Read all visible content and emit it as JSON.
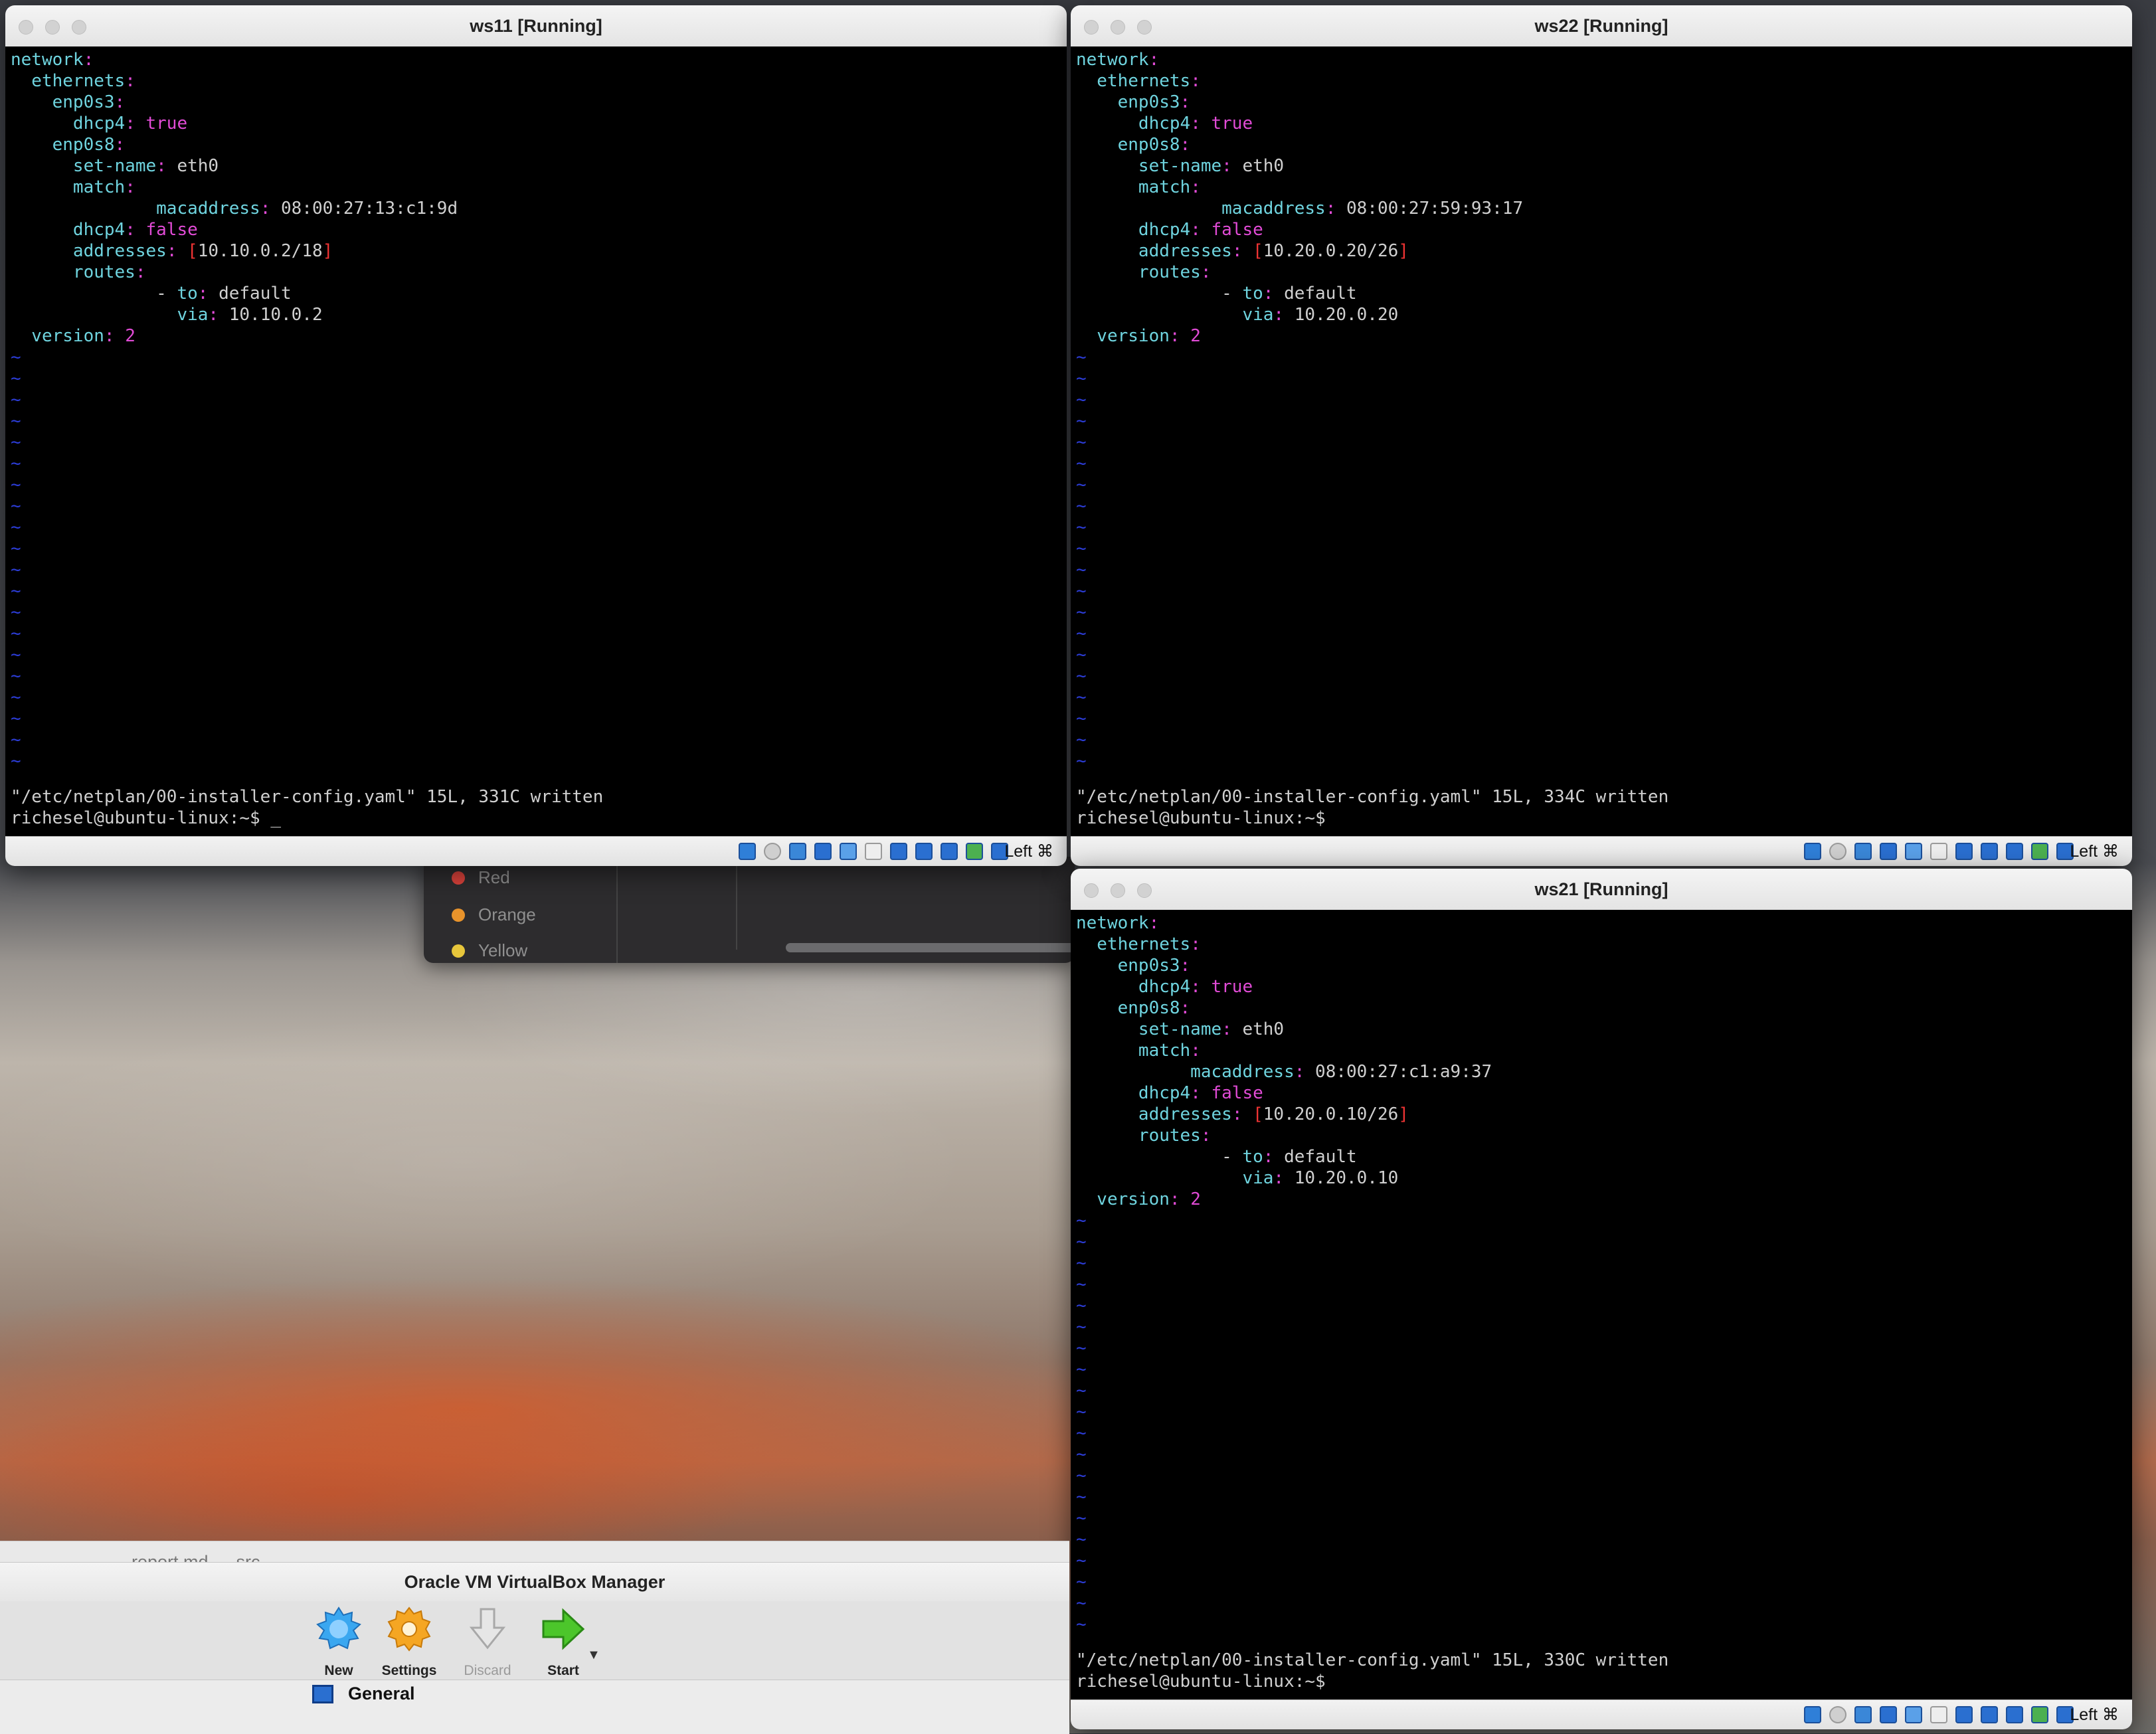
{
  "windows": {
    "ws11": {
      "title": "ws11 [Running]",
      "lines": [
        [
          {
            "t": "network",
            "c": "k"
          },
          {
            "t": ":",
            "c": "p"
          }
        ],
        [
          {
            "t": "  ethernets",
            "c": "k"
          },
          {
            "t": ":",
            "c": "p"
          }
        ],
        [
          {
            "t": "    enp0s3",
            "c": "k"
          },
          {
            "t": ":",
            "c": "p"
          }
        ],
        [
          {
            "t": "      dhcp4",
            "c": "k"
          },
          {
            "t": ": ",
            "c": "p"
          },
          {
            "t": "true",
            "c": "p"
          }
        ],
        [
          {
            "t": "    enp0s8",
            "c": "k"
          },
          {
            "t": ":",
            "c": "p"
          }
        ],
        [
          {
            "t": "      set-name",
            "c": "k"
          },
          {
            "t": ": ",
            "c": "p"
          },
          {
            "t": "eth0",
            "c": "v"
          }
        ],
        [
          {
            "t": "      match",
            "c": "k"
          },
          {
            "t": ":",
            "c": "p"
          }
        ],
        [
          {
            "t": "              macaddress",
            "c": "k"
          },
          {
            "t": ": ",
            "c": "p"
          },
          {
            "t": "08:00:27:13:c1:9d",
            "c": "v"
          }
        ],
        [
          {
            "t": "      dhcp4",
            "c": "k"
          },
          {
            "t": ": ",
            "c": "p"
          },
          {
            "t": "false",
            "c": "p"
          }
        ],
        [
          {
            "t": "      addresses",
            "c": "k"
          },
          {
            "t": ": ",
            "c": "p"
          },
          {
            "t": "[",
            "c": "br"
          },
          {
            "t": "10.10.0.2/18",
            "c": "v"
          },
          {
            "t": "]",
            "c": "br"
          }
        ],
        [
          {
            "t": "      routes",
            "c": "k"
          },
          {
            "t": ":",
            "c": "p"
          }
        ],
        [
          {
            "t": "              - ",
            "c": "v"
          },
          {
            "t": "to",
            "c": "k"
          },
          {
            "t": ": ",
            "c": "p"
          },
          {
            "t": "default",
            "c": "v"
          }
        ],
        [
          {
            "t": "                via",
            "c": "k"
          },
          {
            "t": ": ",
            "c": "p"
          },
          {
            "t": "10.10.0.2",
            "c": "v"
          }
        ],
        [
          {
            "t": "  version",
            "c": "k"
          },
          {
            "t": ": ",
            "c": "p"
          },
          {
            "t": "2",
            "c": "p"
          }
        ]
      ],
      "status_line": "\"/etc/netplan/00-installer-config.yaml\" 15L, 331C written",
      "prompt": "richesel@ubuntu-linux:~$ ",
      "cursor": "_",
      "host_key": "Left ⌘"
    },
    "ws22": {
      "title": "ws22 [Running]",
      "lines": [
        [
          {
            "t": "network",
            "c": "k"
          },
          {
            "t": ":",
            "c": "p"
          }
        ],
        [
          {
            "t": "  ethernets",
            "c": "k"
          },
          {
            "t": ":",
            "c": "p"
          }
        ],
        [
          {
            "t": "    enp0s3",
            "c": "k"
          },
          {
            "t": ":",
            "c": "p"
          }
        ],
        [
          {
            "t": "      dhcp4",
            "c": "k"
          },
          {
            "t": ": ",
            "c": "p"
          },
          {
            "t": "true",
            "c": "p"
          }
        ],
        [
          {
            "t": "    enp0s8",
            "c": "k"
          },
          {
            "t": ":",
            "c": "p"
          }
        ],
        [
          {
            "t": "      set-name",
            "c": "k"
          },
          {
            "t": ": ",
            "c": "p"
          },
          {
            "t": "eth0",
            "c": "v"
          }
        ],
        [
          {
            "t": "      match",
            "c": "k"
          },
          {
            "t": ":",
            "c": "p"
          }
        ],
        [
          {
            "t": "              macaddress",
            "c": "k"
          },
          {
            "t": ": ",
            "c": "p"
          },
          {
            "t": "08:00:27:59:93:17",
            "c": "v"
          }
        ],
        [
          {
            "t": "      dhcp4",
            "c": "k"
          },
          {
            "t": ": ",
            "c": "p"
          },
          {
            "t": "false",
            "c": "p"
          }
        ],
        [
          {
            "t": "      addresses",
            "c": "k"
          },
          {
            "t": ": ",
            "c": "p"
          },
          {
            "t": "[",
            "c": "br"
          },
          {
            "t": "10.20.0.20/26",
            "c": "v"
          },
          {
            "t": "]",
            "c": "br"
          }
        ],
        [
          {
            "t": "      routes",
            "c": "k"
          },
          {
            "t": ":",
            "c": "p"
          }
        ],
        [
          {
            "t": "              - ",
            "c": "v"
          },
          {
            "t": "to",
            "c": "k"
          },
          {
            "t": ": ",
            "c": "p"
          },
          {
            "t": "default",
            "c": "v"
          }
        ],
        [
          {
            "t": "                via",
            "c": "k"
          },
          {
            "t": ": ",
            "c": "p"
          },
          {
            "t": "10.20.0.20",
            "c": "v"
          }
        ],
        [
          {
            "t": "  version",
            "c": "k"
          },
          {
            "t": ": ",
            "c": "p"
          },
          {
            "t": "2",
            "c": "p"
          }
        ]
      ],
      "status_line": "\"/etc/netplan/00-installer-config.yaml\" 15L, 334C written",
      "prompt": "richesel@ubuntu-linux:~$",
      "cursor": "",
      "host_key": "Left ⌘"
    },
    "ws21": {
      "title": "ws21 [Running]",
      "lines": [
        [
          {
            "t": "network",
            "c": "k"
          },
          {
            "t": ":",
            "c": "p"
          }
        ],
        [
          {
            "t": "  ethernets",
            "c": "k"
          },
          {
            "t": ":",
            "c": "p"
          }
        ],
        [
          {
            "t": "    enp0s3",
            "c": "k"
          },
          {
            "t": ":",
            "c": "p"
          }
        ],
        [
          {
            "t": "      dhcp4",
            "c": "k"
          },
          {
            "t": ": ",
            "c": "p"
          },
          {
            "t": "true",
            "c": "p"
          }
        ],
        [
          {
            "t": "    enp0s8",
            "c": "k"
          },
          {
            "t": ":",
            "c": "p"
          }
        ],
        [
          {
            "t": "      set-name",
            "c": "k"
          },
          {
            "t": ": ",
            "c": "p"
          },
          {
            "t": "eth0",
            "c": "v"
          }
        ],
        [
          {
            "t": "      match",
            "c": "k"
          },
          {
            "t": ":",
            "c": "p"
          }
        ],
        [
          {
            "t": "           macaddress",
            "c": "k"
          },
          {
            "t": ": ",
            "c": "p"
          },
          {
            "t": "08:00:27:c1:a9:37",
            "c": "v"
          }
        ],
        [
          {
            "t": "      dhcp4",
            "c": "k"
          },
          {
            "t": ": ",
            "c": "p"
          },
          {
            "t": "false",
            "c": "p"
          }
        ],
        [
          {
            "t": "      addresses",
            "c": "k"
          },
          {
            "t": ": ",
            "c": "p"
          },
          {
            "t": "[",
            "c": "br"
          },
          {
            "t": "10.20.0.10/26",
            "c": "v"
          },
          {
            "t": "]",
            "c": "br"
          }
        ],
        [
          {
            "t": "      routes",
            "c": "k"
          },
          {
            "t": ":",
            "c": "p"
          }
        ],
        [
          {
            "t": "              - ",
            "c": "v"
          },
          {
            "t": "to",
            "c": "k"
          },
          {
            "t": ": ",
            "c": "p"
          },
          {
            "t": "default",
            "c": "v"
          }
        ],
        [
          {
            "t": "                via",
            "c": "k"
          },
          {
            "t": ": ",
            "c": "p"
          },
          {
            "t": "10.20.0.10",
            "c": "v"
          }
        ],
        [
          {
            "t": "  version",
            "c": "k"
          },
          {
            "t": ": ",
            "c": "p"
          },
          {
            "t": "2",
            "c": "p"
          }
        ]
      ],
      "status_line": "\"/etc/netplan/00-installer-config.yaml\" 15L, 330C written",
      "prompt": "richesel@ubuntu-linux:~$",
      "cursor": "",
      "host_key": "Left ⌘"
    }
  },
  "tilde": "~",
  "status_icons": [
    "optical-drive-icon",
    "audio-icon",
    "network-icon",
    "usb-icon",
    "shared-folder-icon",
    "display-icon",
    "recording-icon",
    "snapshot-icon",
    "cpu-icon",
    "mouse-integration-icon",
    "keyboard-capture-icon"
  ],
  "tag_menu": {
    "items": [
      {
        "label": "Red",
        "color": "#d9423b"
      },
      {
        "label": "Orange",
        "color": "#e8932b"
      },
      {
        "label": "Yellow",
        "color": "#e7c63b"
      }
    ]
  },
  "background_window": {
    "title": "report.md — src"
  },
  "vbox_manager": {
    "title": "Oracle VM VirtualBox Manager",
    "toolbar": {
      "new": "New",
      "settings": "Settings",
      "discard": "Discard",
      "start": "Start"
    },
    "section": "General"
  }
}
